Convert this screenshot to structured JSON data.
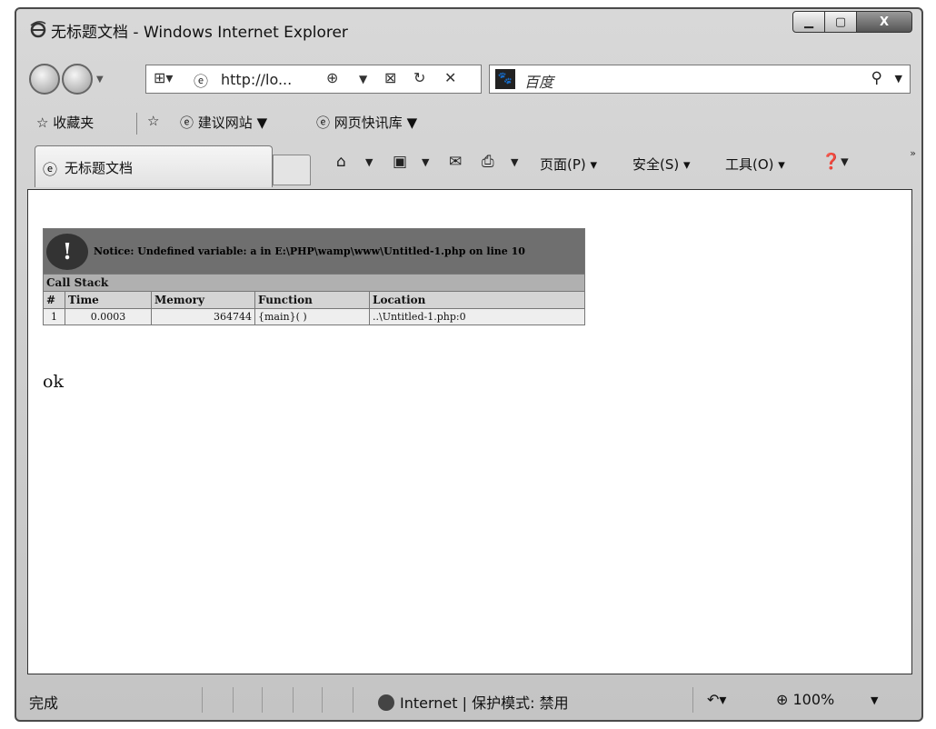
{
  "window": {
    "title": "无标题文档 - Windows Internet Explorer",
    "controls": {
      "minimize": "▁",
      "maximize": "▢",
      "close": "X"
    }
  },
  "nav": {
    "address_text": "http://lo...",
    "search_placeholder": "百度"
  },
  "favorites": {
    "favorites_label": "收藏夹",
    "items": [
      "建议网站 ▼",
      "网页快讯库 ▼"
    ]
  },
  "tab": {
    "label": "无标题文档"
  },
  "commands": {
    "page": "页面(P) ▾",
    "safety": "安全(S) ▾",
    "tools": "工具(O) ▾"
  },
  "error": {
    "notice": "Notice: Undefined variable: a in E:\\PHP\\wamp\\www\\Untitled-1.php on line 10",
    "call_stack_label": "Call Stack",
    "columns": [
      "#",
      "Time",
      "Memory",
      "Function",
      "Location"
    ],
    "rows": [
      {
        "num": "1",
        "time": "0.0003",
        "memory": "364744",
        "function": "{main}( )",
        "location": "..\\Untitled-1.php:0"
      }
    ]
  },
  "page_output": "ok",
  "status": {
    "done": "完成",
    "zone": "Internet | 保护模式: 禁用",
    "zoom": "100%"
  }
}
